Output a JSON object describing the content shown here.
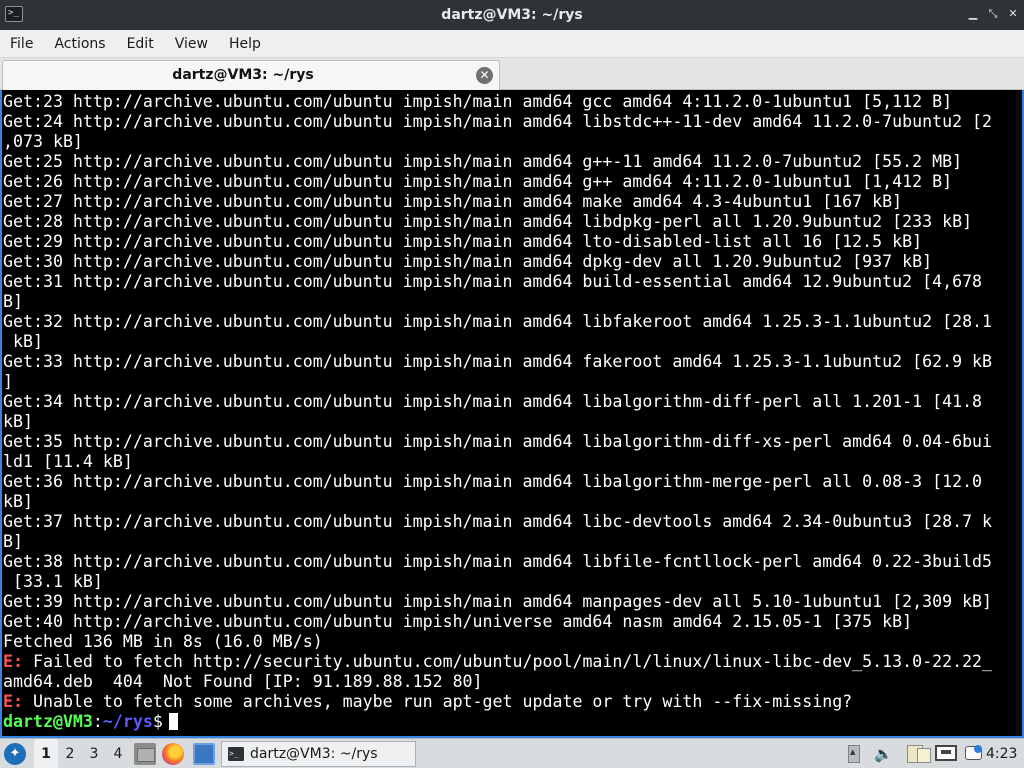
{
  "window": {
    "title": "dartz@VM3: ~/rys",
    "controls": [
      "minimize",
      "maximize",
      "close"
    ]
  },
  "menu": {
    "items": [
      "File",
      "Actions",
      "Edit",
      "View",
      "Help"
    ]
  },
  "tab": {
    "label": "dartz@VM3: ~/rys"
  },
  "terminal": {
    "lines": [
      {
        "type": "text",
        "text": "Get:23 http://archive.ubuntu.com/ubuntu impish/main amd64 gcc amd64 4:11.2.0-1ubuntu1 [5,112 B]"
      },
      {
        "type": "text",
        "text": "Get:24 http://archive.ubuntu.com/ubuntu impish/main amd64 libstdc++-11-dev amd64 11.2.0-7ubuntu2 [2"
      },
      {
        "type": "text",
        "text": ",073 kB]"
      },
      {
        "type": "text",
        "text": "Get:25 http://archive.ubuntu.com/ubuntu impish/main amd64 g++-11 amd64 11.2.0-7ubuntu2 [55.2 MB]"
      },
      {
        "type": "text",
        "text": "Get:26 http://archive.ubuntu.com/ubuntu impish/main amd64 g++ amd64 4:11.2.0-1ubuntu1 [1,412 B]"
      },
      {
        "type": "text",
        "text": "Get:27 http://archive.ubuntu.com/ubuntu impish/main amd64 make amd64 4.3-4ubuntu1 [167 kB]"
      },
      {
        "type": "text",
        "text": "Get:28 http://archive.ubuntu.com/ubuntu impish/main amd64 libdpkg-perl all 1.20.9ubuntu2 [233 kB]"
      },
      {
        "type": "text",
        "text": "Get:29 http://archive.ubuntu.com/ubuntu impish/main amd64 lto-disabled-list all 16 [12.5 kB]"
      },
      {
        "type": "text",
        "text": "Get:30 http://archive.ubuntu.com/ubuntu impish/main amd64 dpkg-dev all 1.20.9ubuntu2 [937 kB]"
      },
      {
        "type": "text",
        "text": "Get:31 http://archive.ubuntu.com/ubuntu impish/main amd64 build-essential amd64 12.9ubuntu2 [4,678"
      },
      {
        "type": "text",
        "text": "B]"
      },
      {
        "type": "text",
        "text": "Get:32 http://archive.ubuntu.com/ubuntu impish/main amd64 libfakeroot amd64 1.25.3-1.1ubuntu2 [28.1"
      },
      {
        "type": "text",
        "text": " kB]"
      },
      {
        "type": "text",
        "text": "Get:33 http://archive.ubuntu.com/ubuntu impish/main amd64 fakeroot amd64 1.25.3-1.1ubuntu2 [62.9 kB"
      },
      {
        "type": "text",
        "text": "]"
      },
      {
        "type": "text",
        "text": "Get:34 http://archive.ubuntu.com/ubuntu impish/main amd64 libalgorithm-diff-perl all 1.201-1 [41.8"
      },
      {
        "type": "text",
        "text": "kB]"
      },
      {
        "type": "text",
        "text": "Get:35 http://archive.ubuntu.com/ubuntu impish/main amd64 libalgorithm-diff-xs-perl amd64 0.04-6bui"
      },
      {
        "type": "text",
        "text": "ld1 [11.4 kB]"
      },
      {
        "type": "text",
        "text": "Get:36 http://archive.ubuntu.com/ubuntu impish/main amd64 libalgorithm-merge-perl all 0.08-3 [12.0"
      },
      {
        "type": "text",
        "text": "kB]"
      },
      {
        "type": "text",
        "text": "Get:37 http://archive.ubuntu.com/ubuntu impish/main amd64 libc-devtools amd64 2.34-0ubuntu3 [28.7 k"
      },
      {
        "type": "text",
        "text": "B]"
      },
      {
        "type": "text",
        "text": "Get:38 http://archive.ubuntu.com/ubuntu impish/main amd64 libfile-fcntllock-perl amd64 0.22-3build5"
      },
      {
        "type": "text",
        "text": " [33.1 kB]"
      },
      {
        "type": "text",
        "text": "Get:39 http://archive.ubuntu.com/ubuntu impish/main amd64 manpages-dev all 5.10-1ubuntu1 [2,309 kB]"
      },
      {
        "type": "text",
        "text": "Get:40 http://archive.ubuntu.com/ubuntu impish/universe amd64 nasm amd64 2.15.05-1 [375 kB]"
      },
      {
        "type": "text",
        "text": "Fetched 136 MB in 8s (16.0 MB/s)"
      },
      {
        "type": "error",
        "tag": "E:",
        "text": " Failed to fetch http://security.ubuntu.com/ubuntu/pool/main/l/linux/linux-libc-dev_5.13.0-22.22_"
      },
      {
        "type": "text",
        "text": "amd64.deb  404  Not Found [IP: 91.189.88.152 80]"
      },
      {
        "type": "error",
        "tag": "E:",
        "text": " Unable to fetch some archives, maybe run apt-get update or try with --fix-missing?"
      }
    ],
    "prompt": {
      "user_host": "dartz@VM3",
      "separator": ":",
      "path": "~/rys",
      "symbol": "$"
    }
  },
  "taskbar": {
    "desktops": [
      "1",
      "2",
      "3",
      "4"
    ],
    "active_desktop": "1",
    "launchers": [
      "file-manager-icon",
      "firefox-icon",
      "show-desktop-icon"
    ],
    "task_label": "dartz@VM3: ~/rys",
    "clock": "4:23"
  },
  "colors": {
    "error": "#ff5555",
    "prompt_user": "#55ff55",
    "prompt_path": "#5c5cff",
    "accent_border": "#3584e4"
  }
}
